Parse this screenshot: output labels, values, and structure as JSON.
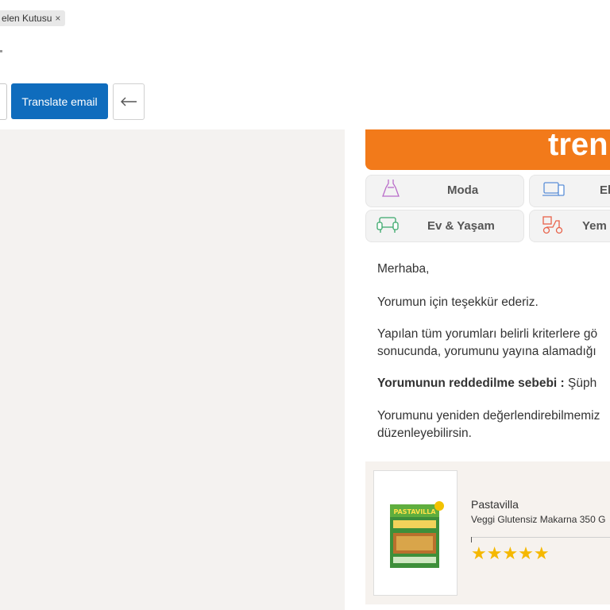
{
  "header": {
    "folder_tag": "elen Kutusu",
    "tag_close": "×"
  },
  "toolbar": {
    "translate_label": "Translate email",
    "back_glyph": "⟵"
  },
  "email": {
    "brand_banner": "tren",
    "banner_color": "#f27a1a",
    "categories": [
      {
        "label": "Moda",
        "icon": "dress-icon"
      },
      {
        "label": "El",
        "icon": "electronics-icon"
      },
      {
        "label": "Ev & Yaşam",
        "icon": "sofa-icon"
      },
      {
        "label": "Yem",
        "icon": "food-delivery-icon"
      }
    ],
    "greeting": "Merhaba,",
    "thanks": "Yorumun için teşekkür ederiz.",
    "para1_line1": "Yapılan tüm yorumları belirli kriterlere gö",
    "para1_line2": "sonucunda, yorumunu yayına alamadığı",
    "reason_label": "Yorumunun reddedilme sebebi :",
    "reason_value": " Şüph",
    "para2_line1": "Yorumunu yeniden değerlendirebilmemiz",
    "para2_line2": "düzenleyebilirsin."
  },
  "product": {
    "brand": "Pastavilla",
    "name": "Veggi Glutensiz Makarna 350 G",
    "package_text": "PASTAVILLA",
    "stars": "★★★★★",
    "rating": 5
  }
}
